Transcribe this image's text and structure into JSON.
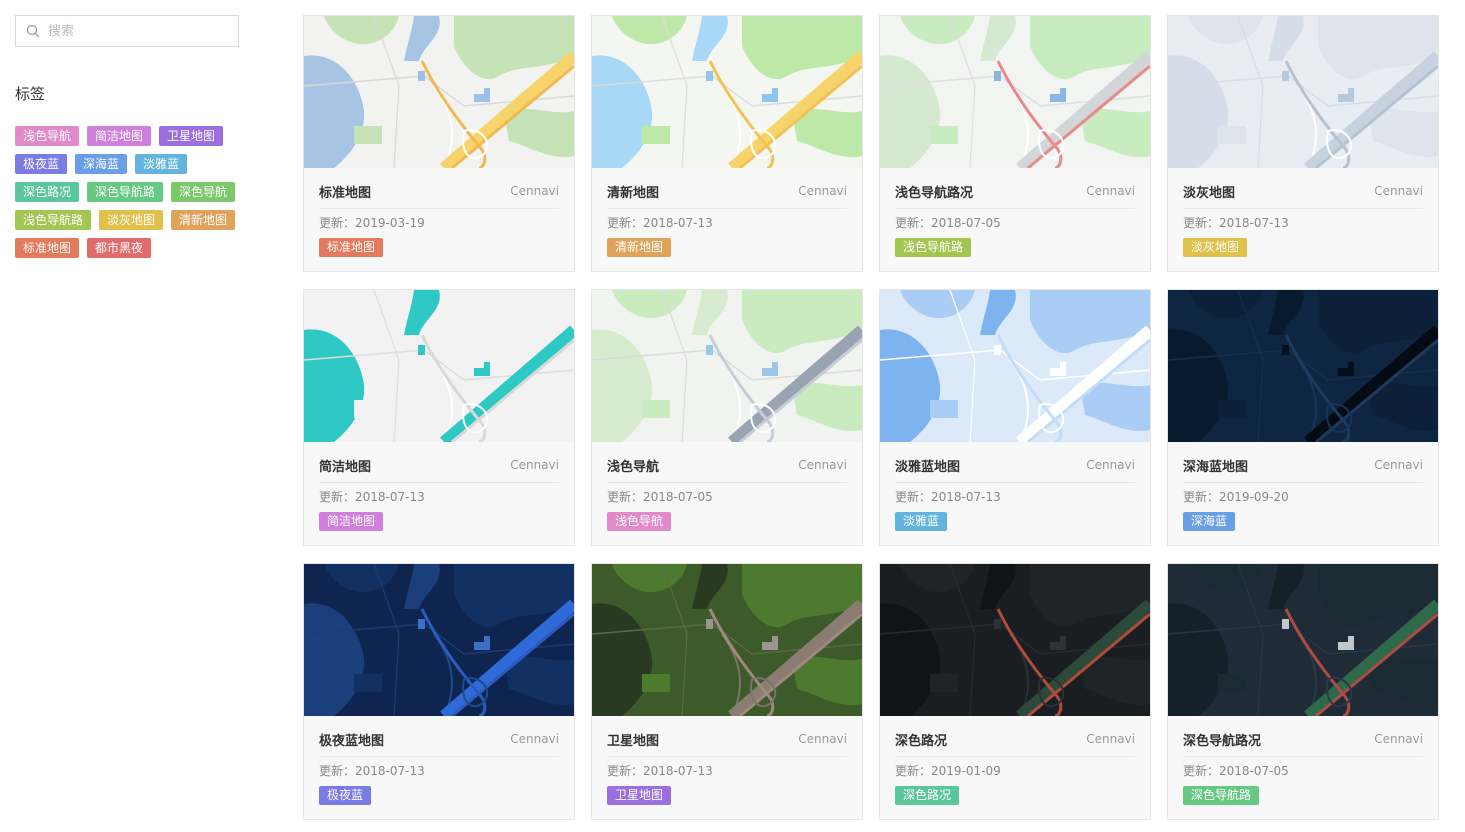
{
  "search": {
    "placeholder": "搜索"
  },
  "tags_title": "标签",
  "tag_list": [
    {
      "label": "浅色导航",
      "color": "#e28ac9"
    },
    {
      "label": "简洁地图",
      "color": "#d17fdc"
    },
    {
      "label": "卫星地图",
      "color": "#9b6fe0"
    },
    {
      "label": "极夜蓝",
      "color": "#7a7be3"
    },
    {
      "label": "深海蓝",
      "color": "#6a9ee6"
    },
    {
      "label": "淡雅蓝",
      "color": "#62b4de"
    },
    {
      "label": "深色路况",
      "color": "#5cc69b"
    },
    {
      "label": "深色导航路",
      "color": "#67c883"
    },
    {
      "label": "深色导航",
      "color": "#7dc86a"
    },
    {
      "label": "浅色导航路",
      "color": "#a3c652"
    },
    {
      "label": "淡灰地图",
      "color": "#dfc14c"
    },
    {
      "label": "清新地图",
      "color": "#e0a35c"
    },
    {
      "label": "标准地图",
      "color": "#e37a5c"
    },
    {
      "label": "都市黑夜",
      "color": "#e06b6b"
    }
  ],
  "cards": [
    {
      "title": "标准地图",
      "vendor": "Cennavi",
      "date": "更新：2019-03-19",
      "tag": "标准地图",
      "tag_color": "#e37a5c",
      "theme": "standard"
    },
    {
      "title": "清新地图",
      "vendor": "Cennavi",
      "date": "更新：2018-07-13",
      "tag": "清新地图",
      "tag_color": "#e0a35c",
      "theme": "fresh"
    },
    {
      "title": "浅色导航路况",
      "vendor": "Cennavi",
      "date": "更新：2018-07-05",
      "tag": "浅色导航路",
      "tag_color": "#a3c652",
      "theme": "lightnavtraffic"
    },
    {
      "title": "淡灰地图",
      "vendor": "Cennavi",
      "date": "更新：2018-07-13",
      "tag": "淡灰地图",
      "tag_color": "#dfc14c",
      "theme": "gray"
    },
    {
      "title": "简洁地图",
      "vendor": "Cennavi",
      "date": "更新：2018-07-13",
      "tag": "简洁地图",
      "tag_color": "#d17fdc",
      "theme": "simple"
    },
    {
      "title": "浅色导航",
      "vendor": "Cennavi",
      "date": "更新：2018-07-05",
      "tag": "浅色导航",
      "tag_color": "#e28ac9",
      "theme": "lightnav"
    },
    {
      "title": "淡雅蓝地图",
      "vendor": "Cennavi",
      "date": "更新：2018-07-13",
      "tag": "淡雅蓝",
      "tag_color": "#62b4de",
      "theme": "elegantblue"
    },
    {
      "title": "深海蓝地图",
      "vendor": "Cennavi",
      "date": "更新：2019-09-20",
      "tag": "深海蓝",
      "tag_color": "#6a9ee6",
      "theme": "deepsea"
    },
    {
      "title": "极夜蓝地图",
      "vendor": "Cennavi",
      "date": "更新：2018-07-13",
      "tag": "极夜蓝",
      "tag_color": "#7a7be3",
      "theme": "polarnight"
    },
    {
      "title": "卫星地图",
      "vendor": "Cennavi",
      "date": "更新：2018-07-13",
      "tag": "卫星地图",
      "tag_color": "#9b6fe0",
      "theme": "satellite"
    },
    {
      "title": "深色路况",
      "vendor": "Cennavi",
      "date": "更新：2019-01-09",
      "tag": "深色路况",
      "tag_color": "#5cc69b",
      "theme": "darktraffic"
    },
    {
      "title": "深色导航路况",
      "vendor": "Cennavi",
      "date": "更新：2018-07-05",
      "tag": "深色导航路",
      "tag_color": "#67c883",
      "theme": "darknavtraffic"
    }
  ]
}
